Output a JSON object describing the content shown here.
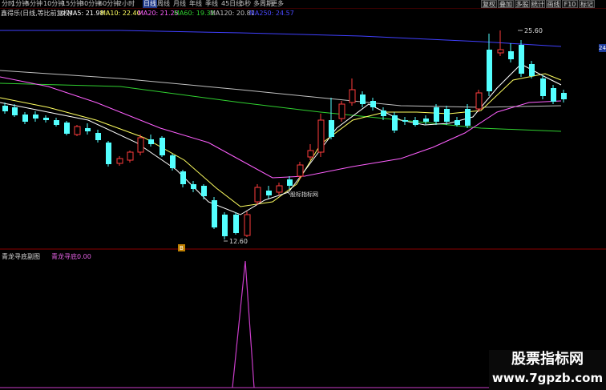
{
  "toolbar": {
    "timeframes": [
      "分时",
      "1分钟",
      "5分钟",
      "10分钟",
      "15分钟",
      "30分钟",
      "60分钟",
      "2小时",
      "日线",
      "周线",
      "月线",
      "年线",
      "季线",
      "45日线",
      "5秒",
      "多周期",
      "更多"
    ],
    "active_timeframe": "日线",
    "right_buttons": [
      "复权",
      "叠加",
      "多股",
      "统计",
      "画线",
      "F10",
      "标记"
    ]
  },
  "ma_bar": {
    "title": "鑫得乐(日线,等比前复权)",
    "ma5": "MA5: 21.98",
    "ma10": "MA10: 22.40",
    "ma20": "MA20: 21.25",
    "ma60": "MA60: 19.31",
    "ma120": "MA120: 20.81",
    "ma250": "MA250: 24.57"
  },
  "colors": {
    "up": "#ff3d3d",
    "down": "#54ffff",
    "ma5": "#ffffff",
    "ma10": "#ffff60",
    "ma20": "#ff60ff",
    "ma60": "#30d030",
    "ma120": "#c0c0c0",
    "ma250": "#4040ff"
  },
  "annotations": {
    "high": "25.60",
    "low": "12.60",
    "watermark_mark": "股标指标网",
    "signal_marker": "B"
  },
  "price_tag": "24",
  "sub_panel": {
    "title": "青龙寻底副图",
    "indicator": "青龙寻底:",
    "value": "0.00"
  },
  "watermark": {
    "line1": "股票指标网",
    "line2": "www.7gpzb.com"
  }
}
